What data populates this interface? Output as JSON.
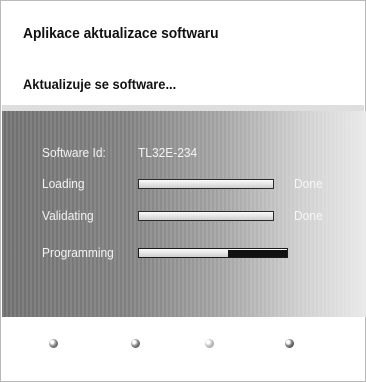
{
  "header": {
    "title": "Aplikace aktualizace softwaru",
    "subtitle": "Aktualizuje se software..."
  },
  "info": {
    "software_id_label": "Software Id:",
    "software_id_value": "TL32E-234"
  },
  "steps": [
    {
      "label": "Loading",
      "progress": 1.0,
      "status": "Done"
    },
    {
      "label": "Validating",
      "progress": 1.0,
      "status": "Done"
    },
    {
      "label": "Programming",
      "progress": 0.6,
      "status": ""
    }
  ],
  "color_buttons": [
    {
      "name": "red",
      "icon": "red-key-icon",
      "color": "#c00000"
    },
    {
      "name": "green",
      "icon": "green-key-icon",
      "color": "#00a000"
    },
    {
      "name": "yellow",
      "icon": "yellow-key-icon",
      "color": "#e0c000"
    },
    {
      "name": "blue",
      "icon": "blue-key-icon",
      "color": "#0040c0"
    }
  ]
}
